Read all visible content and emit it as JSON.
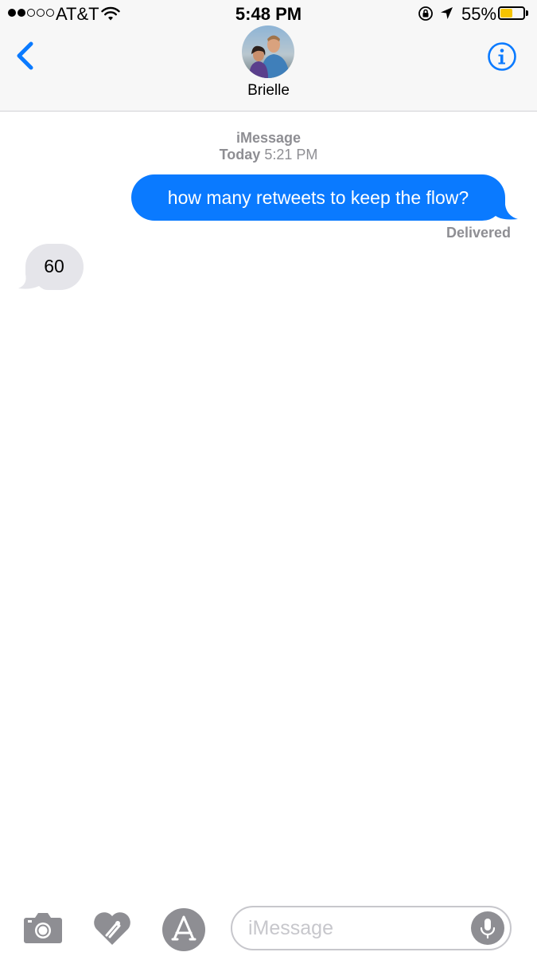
{
  "status_bar": {
    "signal_bars_filled": 2,
    "signal_bars_total": 5,
    "carrier": "AT&T",
    "time": "5:48 PM",
    "battery_percent_label": "55%",
    "battery_level": 0.55,
    "battery_color": "#f5c400",
    "icons": [
      "wifi-icon",
      "rotation-lock-icon",
      "location-arrow-icon",
      "battery-icon"
    ]
  },
  "header": {
    "back_icon": "chevron-left-icon",
    "contact_name": "Brielle",
    "info_icon": "info-circle-icon"
  },
  "conversation": {
    "service": "iMessage",
    "timestamp_day": "Today",
    "timestamp_time": "5:21 PM",
    "messages": [
      {
        "direction": "outgoing",
        "text": "how many retweets to keep the flow?",
        "status": "Delivered"
      },
      {
        "direction": "incoming",
        "text": "60"
      }
    ]
  },
  "input_bar": {
    "placeholder": "iMessage",
    "icons": [
      "camera-icon",
      "digital-touch-icon",
      "app-store-icon",
      "microphone-icon"
    ]
  },
  "colors": {
    "accent": "#0a7aff",
    "outgoing_bubble": "#0a7aff",
    "incoming_bubble": "#e5e5ea",
    "secondary_text": "#8e8e93",
    "icon_gray": "#8e8e93"
  }
}
